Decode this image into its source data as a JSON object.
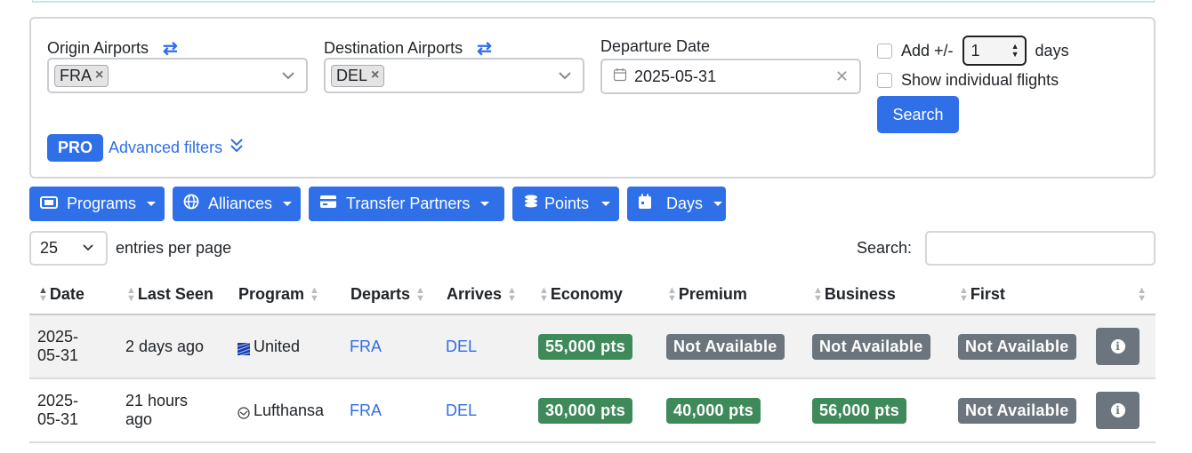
{
  "filters": {
    "origin_label": "Origin Airports",
    "origin_tag": "FRA",
    "destination_label": "Destination Airports",
    "destination_tag": "DEL",
    "date_label": "Departure Date",
    "date_value": "2025-05-31",
    "add_days_label": "Add +/-",
    "add_days_value": "1",
    "days_label": "days",
    "show_individual_label": "Show individual flights",
    "search_button": "Search",
    "pro_badge": "PRO",
    "advanced_filters": "Advanced filters"
  },
  "toolbar": {
    "programs": "Programs",
    "alliances": "Alliances",
    "transfer_partners": "Transfer Partners",
    "points": "Points",
    "days": "Days"
  },
  "table_controls": {
    "entries_value": "25",
    "entries_label": "entries per page",
    "search_label": "Search:"
  },
  "table": {
    "columns": [
      "Date",
      "Last Seen",
      "Program",
      "Departs",
      "Arrives",
      "Economy",
      "Premium",
      "Business",
      "First"
    ],
    "rows": [
      {
        "date_line1": "2025-",
        "date_line2": "05-31",
        "last_seen": "2 days ago",
        "program": "United",
        "departs": "FRA",
        "arrives": "DEL",
        "economy": "55,000 pts",
        "premium": "Not Available",
        "business": "Not Available",
        "first": "Not Available"
      },
      {
        "date_line1": "2025-",
        "date_line2": "05-31",
        "last_seen_line1": "21 hours",
        "last_seen_line2": "ago",
        "program": "Lufthansa",
        "departs": "FRA",
        "arrives": "DEL",
        "economy": "30,000 pts",
        "premium": "40,000 pts",
        "business": "56,000 pts",
        "first": "Not Available"
      }
    ]
  },
  "colors": {
    "primary": "#2f6fe8",
    "available": "#3f8a5a",
    "unavailable": "#6c757d"
  }
}
